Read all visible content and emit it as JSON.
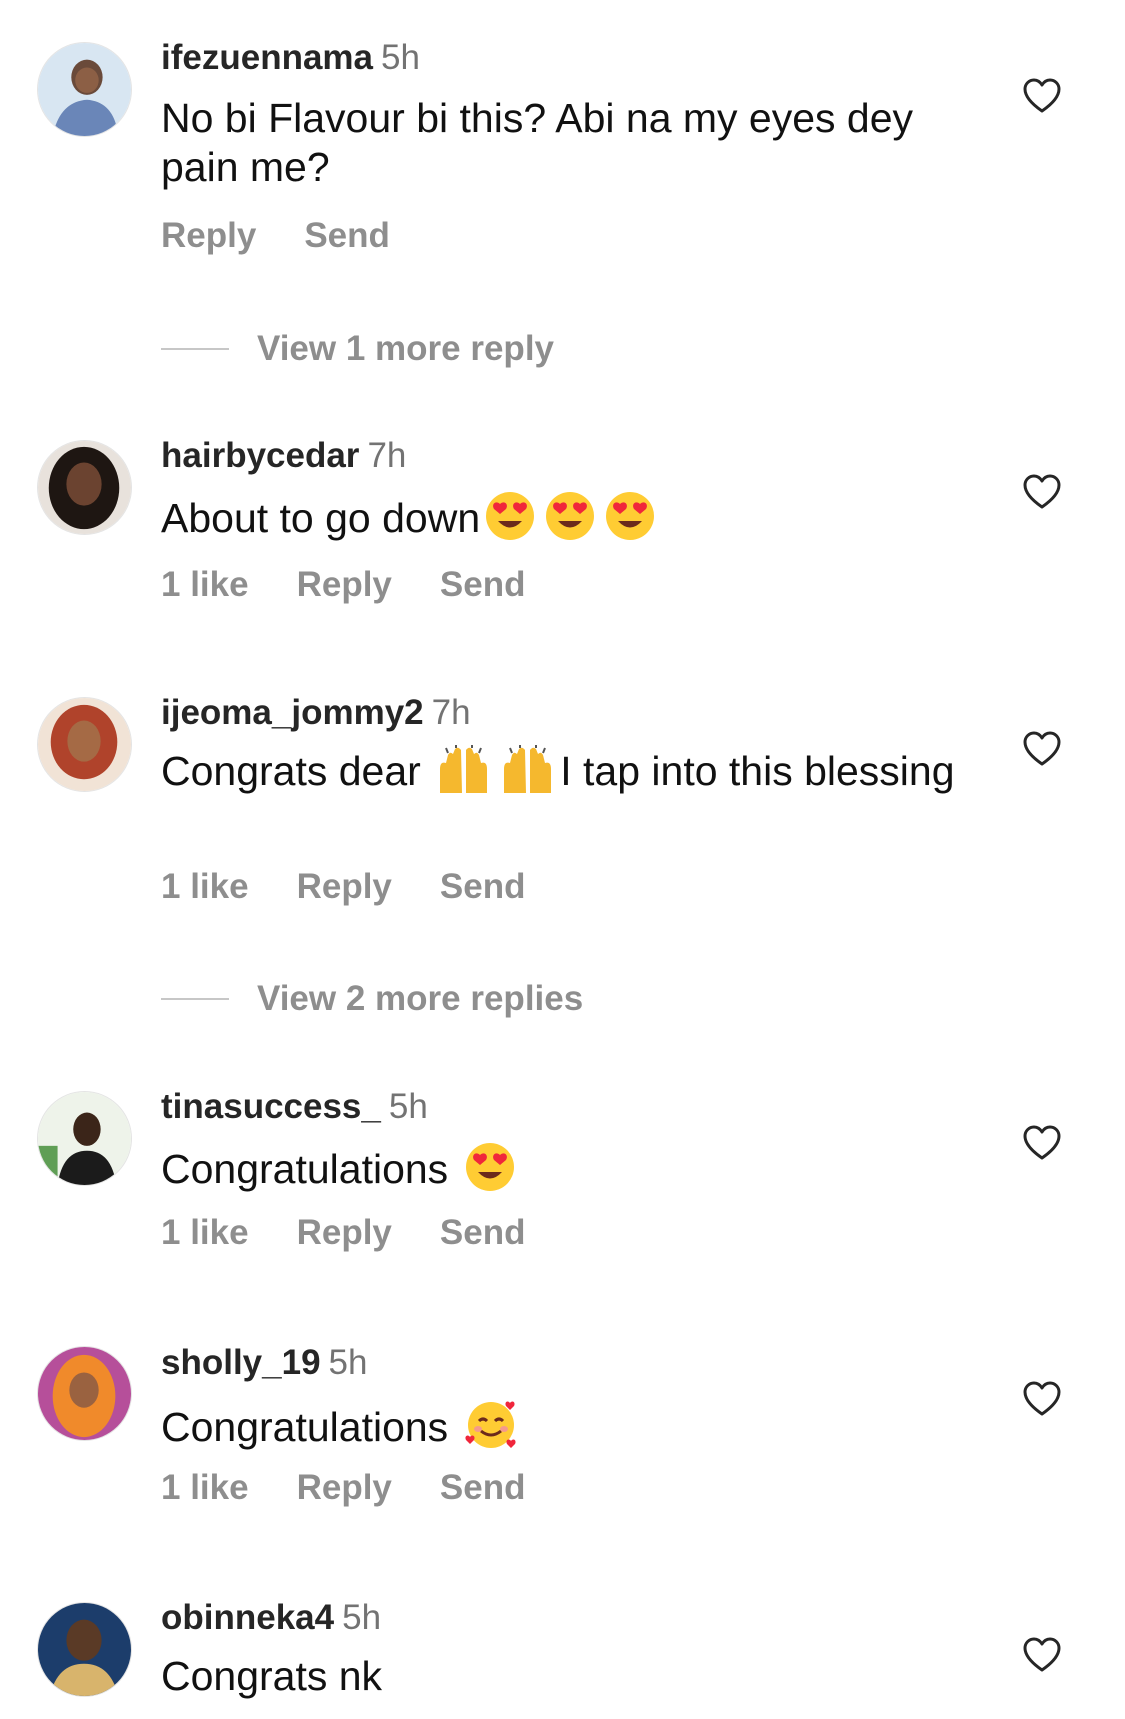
{
  "comments": [
    {
      "username": "ifezuennama",
      "time": "5h",
      "text_parts": [
        "No bi Flavour bi this? Abi na my eyes dey pain me?"
      ],
      "likes": "",
      "reply_label": "Reply",
      "send_label": "Send",
      "avatar_colors": [
        "#cfe0ee",
        "#6a7fa8"
      ]
    },
    {
      "username": "hairbycedar",
      "time": "7h",
      "text_parts": [
        "About to go down"
      ],
      "emojis": [
        "heart-eyes-emoji",
        "heart-eyes-emoji",
        "heart-eyes-emoji"
      ],
      "likes": "1 like",
      "reply_label": "Reply",
      "send_label": "Send",
      "avatar_colors": [
        "#2a1d17",
        "#8a5a3c"
      ]
    },
    {
      "username": "ijeoma_jommy2",
      "time": "7h",
      "text_parts": [
        "Congrats dear",
        "I tap into this blessing"
      ],
      "emojis": [
        "raising-hands-emoji",
        "raising-hands-emoji"
      ],
      "likes": "1 like",
      "reply_label": "Reply",
      "send_label": "Send",
      "avatar_colors": [
        "#d9a37a",
        "#b0432b"
      ]
    },
    {
      "username": "tinasuccess_",
      "time": "5h",
      "text_parts": [
        "Congratulations"
      ],
      "emojis": [
        "heart-eyes-emoji"
      ],
      "likes": "1 like",
      "reply_label": "Reply",
      "send_label": "Send",
      "avatar_colors": [
        "#eaf1e7",
        "#1f1f1f"
      ]
    },
    {
      "username": "sholly_19",
      "time": "5h",
      "text_parts": [
        "Congratulations"
      ],
      "emojis": [
        "smiling-face-with-hearts-emoji"
      ],
      "likes": "1 like",
      "reply_label": "Reply",
      "send_label": "Send",
      "avatar_colors": [
        "#c85ea7",
        "#f08a2b"
      ]
    },
    {
      "username": "obinneka4",
      "time": "5h",
      "text_parts": [
        "Congrats nk"
      ],
      "avatar_colors": [
        "#1c3d6b",
        "#d8b46c"
      ]
    }
  ],
  "view_more": [
    {
      "label": "View 1 more reply"
    },
    {
      "label": "View 2 more replies"
    }
  ],
  "icons": {
    "like": "heart-outline-icon"
  },
  "colors": {
    "username": "#262626",
    "secondary_text": "#8e8e8e",
    "timestamp": "#737373",
    "emoji_face": "#ffcc33",
    "emoji_heart": "#f0263b"
  }
}
